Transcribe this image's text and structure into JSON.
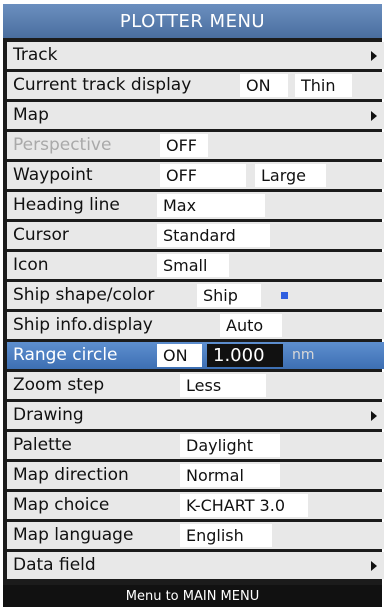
{
  "title": "PLOTTER MENU",
  "footer": "Menu to MAIN MENU",
  "rows": {
    "track": {
      "label": "Track"
    },
    "current_track_display": {
      "label": "Current track display",
      "value1": "ON",
      "value2": "Thin"
    },
    "map": {
      "label": "Map"
    },
    "perspective": {
      "label": "Perspective",
      "value": "OFF"
    },
    "waypoint": {
      "label": "Waypoint",
      "value1": "OFF",
      "value2": "Large"
    },
    "heading_line": {
      "label": "Heading line",
      "value": "Max"
    },
    "cursor": {
      "label": "Cursor",
      "value": "Standard"
    },
    "icon": {
      "label": "Icon",
      "value": "Small"
    },
    "ship_shape_color": {
      "label": "Ship shape/color",
      "value": "Ship",
      "color_swatch": "#2f5fe0"
    },
    "ship_info_display": {
      "label": "Ship info.display",
      "value": "Auto"
    },
    "range_circle": {
      "label": "Range circle",
      "value1": "ON",
      "value2": "1.000",
      "unit": "nm"
    },
    "zoom_step": {
      "label": "Zoom step",
      "value": "Less"
    },
    "drawing": {
      "label": "Drawing"
    },
    "palette": {
      "label": "Palette",
      "value": "Daylight"
    },
    "map_direction": {
      "label": "Map direction",
      "value": "Normal"
    },
    "map_choice": {
      "label": "Map choice",
      "value": "K-CHART 3.0"
    },
    "map_language": {
      "label": "Map language",
      "value": "English"
    },
    "data_field": {
      "label": "Data field"
    }
  },
  "colors": {
    "title_bar": "#5a7fb0",
    "selected_row": "#4a7cc0",
    "row_bg": "#e8e8e8",
    "disabled_text": "#a9a9a9",
    "swatch": "#2f5fe0"
  }
}
